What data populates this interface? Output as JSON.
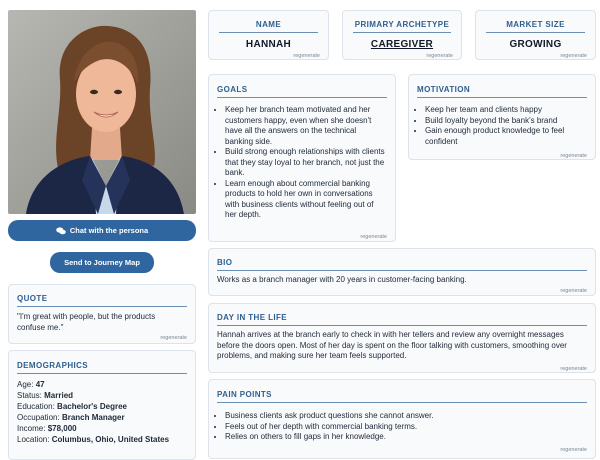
{
  "persona": {
    "name_label": "NAME",
    "name": "HANNAH",
    "archetype_label": "PRIMARY ARCHETYPE",
    "archetype": "CAREGIVER",
    "market_label": "MARKET SIZE",
    "market": "GROWING",
    "regenerate": "regenerate"
  },
  "actions": {
    "chat_label": "Chat with the persona",
    "journey_label": "Send to Journey Map"
  },
  "quote": {
    "title": "QUOTE",
    "text": "\"I'm great with people, but the products confuse me.\""
  },
  "demographics": {
    "title": "DEMOGRAPHICS",
    "rows": [
      {
        "label": "Age:",
        "value": "47"
      },
      {
        "label": "Status:",
        "value": "Married"
      },
      {
        "label": "Education:",
        "value": "Bachelor's Degree"
      },
      {
        "label": "Occupation:",
        "value": "Branch Manager"
      },
      {
        "label": "Income:",
        "value": "$78,000"
      },
      {
        "label": "Location:",
        "value": "Columbus, Ohio, United States"
      }
    ]
  },
  "goals": {
    "title": "GOALS",
    "items": [
      "Keep her branch team motivated and her customers happy, even when she doesn't have all the answers on the technical banking side.",
      "Build strong enough relationships with clients that they stay loyal to her branch, not just the bank.",
      "Learn enough about commercial banking products to hold her own in conversations with business clients without feeling out of her depth."
    ]
  },
  "motivation": {
    "title": "MOTIVATION",
    "items": [
      "Keep her team and clients happy",
      "Build loyalty beyond the bank's brand",
      "Gain enough product knowledge to feel confident"
    ]
  },
  "bio": {
    "title": "BIO",
    "text": "Works as a branch manager with 20 years in customer-facing banking."
  },
  "day": {
    "title": "DAY IN THE LIFE",
    "text": "Hannah arrives at the branch early to check in with her tellers and review any overnight messages before the doors open. Most of her day is spent on the floor talking with customers, smoothing over problems, and making sure her team feels supported."
  },
  "pain": {
    "title": "PAIN POINTS",
    "items": [
      "Business clients ask product questions she cannot answer.",
      "Feels out of her depth with commercial banking terms.",
      "Relies on others to fill gaps in her knowledge."
    ]
  },
  "colors": {
    "accent": "#2f66a0",
    "title": "#2f5f8f",
    "card_bg": "#f8fafc"
  }
}
